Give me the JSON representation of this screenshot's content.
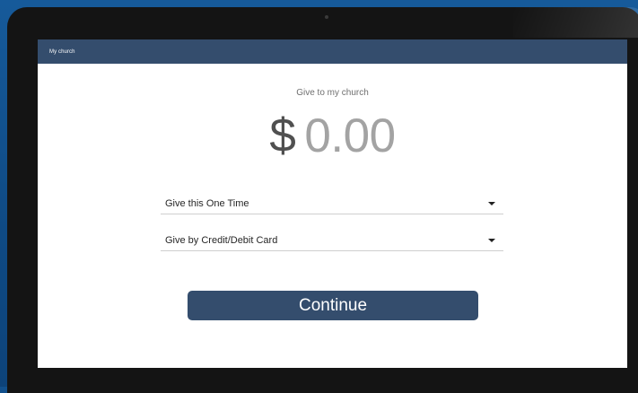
{
  "app_bar": {
    "title": "My church"
  },
  "give": {
    "label": "Give to my church",
    "currency_symbol": "$",
    "amount": "0.00"
  },
  "frequency_select": {
    "value": "Give this One Time",
    "icon": "caret-down-icon"
  },
  "payment_select": {
    "value": "Give by Credit/Debit Card",
    "icon": "caret-down-icon"
  },
  "continue_button": {
    "label": "Continue"
  },
  "colors": {
    "header": "#344d6d",
    "button": "#344d6d",
    "backdrop": "#12508c",
    "amount_placeholder": "#a3a3a3"
  }
}
